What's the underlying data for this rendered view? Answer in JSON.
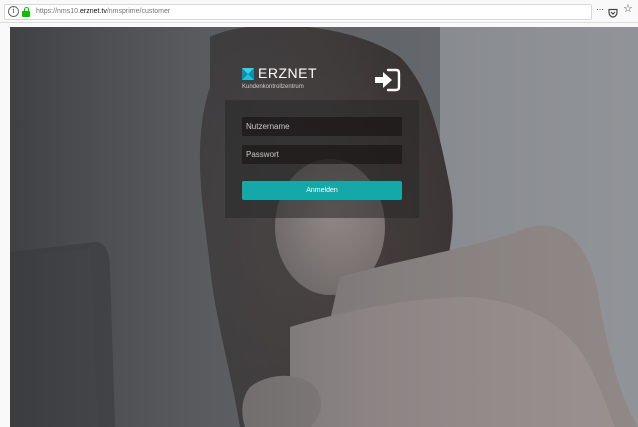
{
  "browser": {
    "url_prefix": "https://nms10.",
    "url_host": "erznet.tv",
    "url_path": "/nmsprime/customer",
    "more_icon": "more-icon",
    "pocket_icon": "pocket-icon",
    "star_icon": "star-icon",
    "info_icon": "info-icon",
    "lock_icon": "lock-icon"
  },
  "brand": {
    "name": "ERZNET",
    "subtitle": "Kundenkontrollzentrum",
    "logo_colors": [
      "#1fc0d4",
      "#0e8fb0"
    ]
  },
  "login": {
    "username_placeholder": "Nutzername",
    "password_placeholder": "Passwort",
    "submit_label": "Anmelden",
    "login_icon": "sign-in-icon"
  },
  "colors": {
    "accent": "#14a8a8",
    "secure_lock": "#12bc00"
  }
}
